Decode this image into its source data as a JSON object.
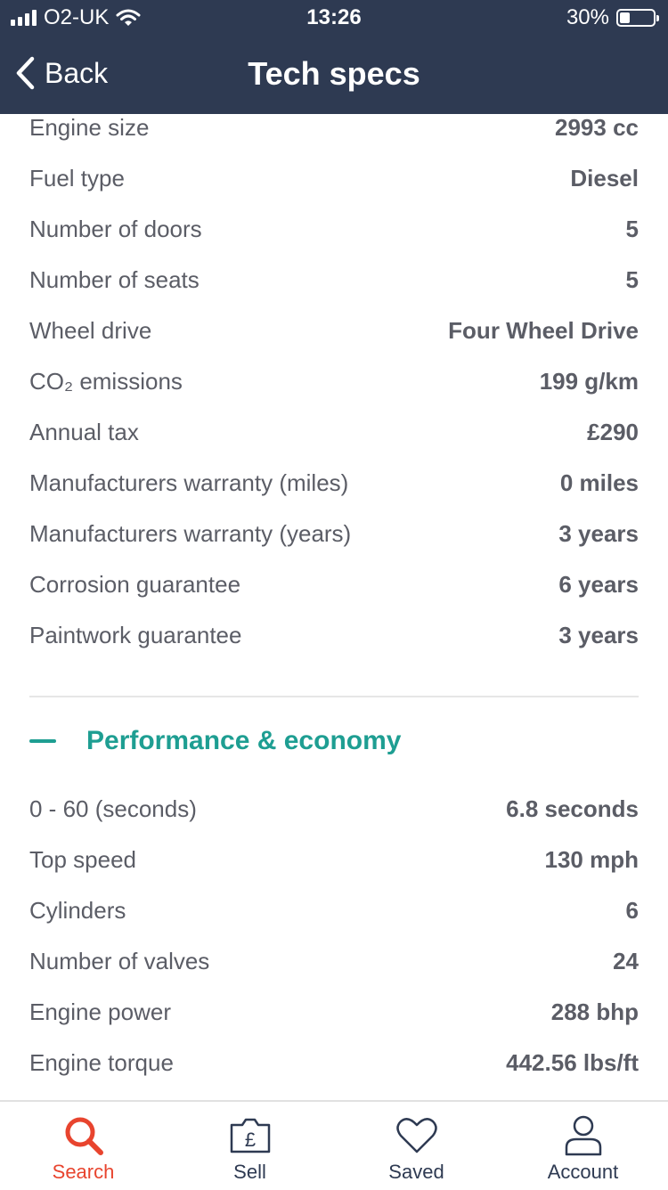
{
  "status": {
    "carrier": "O2-UK",
    "time": "13:26",
    "battery": "30%",
    "battery_level": 0.3
  },
  "nav": {
    "back_label": "Back",
    "title": "Tech specs"
  },
  "specs": [
    {
      "label": "Engine size",
      "value": "2993 cc"
    },
    {
      "label": "Fuel type",
      "value": "Diesel"
    },
    {
      "label": "Number of doors",
      "value": "5"
    },
    {
      "label": "Number of seats",
      "value": "5"
    },
    {
      "label": "Wheel drive",
      "value": "Four Wheel Drive"
    },
    {
      "label": "CO₂ emissions",
      "value": "199 g/km"
    },
    {
      "label": "Annual tax",
      "value": "£290"
    },
    {
      "label": "Manufacturers warranty (miles)",
      "value": "0 miles"
    },
    {
      "label": "Manufacturers warranty (years)",
      "value": "3 years"
    },
    {
      "label": "Corrosion guarantee",
      "value": "6 years"
    },
    {
      "label": "Paintwork guarantee",
      "value": "3 years"
    }
  ],
  "performance": {
    "title": "Performance & economy",
    "rows": [
      {
        "label": "0 - 60 (seconds)",
        "value": "6.8 seconds"
      },
      {
        "label": "Top speed",
        "value": "130 mph"
      },
      {
        "label": "Cylinders",
        "value": "6"
      },
      {
        "label": "Number of valves",
        "value": "24"
      },
      {
        "label": "Engine power",
        "value": "288 bhp"
      },
      {
        "label": "Engine torque",
        "value": "442.56 lbs/ft"
      }
    ]
  },
  "tabs": [
    {
      "label": "Search",
      "icon": "search-icon"
    },
    {
      "label": "Sell",
      "icon": "sell-pound-icon"
    },
    {
      "label": "Saved",
      "icon": "heart-icon"
    },
    {
      "label": "Account",
      "icon": "account-icon"
    }
  ],
  "colors": {
    "header_bg": "#2e3a52",
    "accent_teal": "#1e9e92",
    "active_tab": "#e8442e",
    "text_grey": "#5b5d66"
  }
}
